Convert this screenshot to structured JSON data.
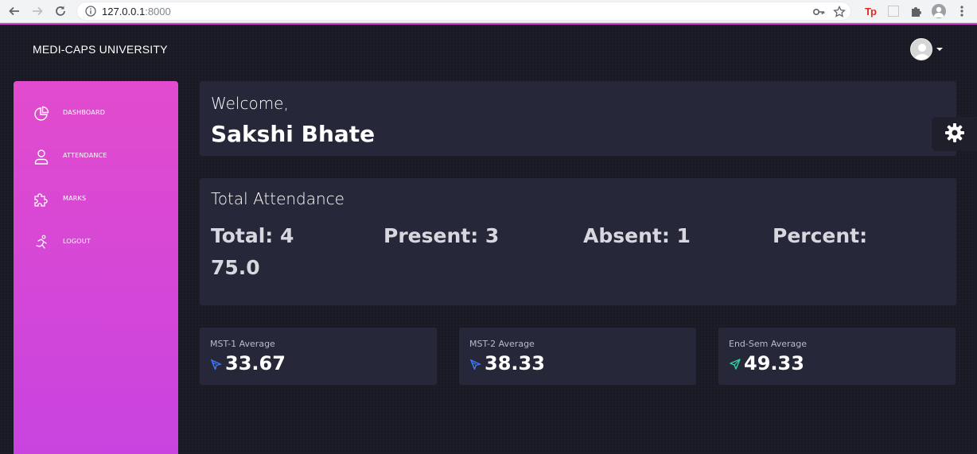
{
  "browser": {
    "url_host": "127.0.0.1",
    "url_port": ":8000",
    "extension_tp": "Tp"
  },
  "app": {
    "brand": "MEDI-CAPS UNIVERSITY",
    "accent_color": "#d63bd0"
  },
  "sidebar": {
    "items": [
      {
        "label": "DASHBOARD",
        "icon": "pie-chart-icon"
      },
      {
        "label": "ATTENDANCE",
        "icon": "user-icon"
      },
      {
        "label": "MARKS",
        "icon": "puzzle-icon"
      },
      {
        "label": "LOGOUT",
        "icon": "running-person-icon"
      }
    ]
  },
  "welcome": {
    "label": "Welcome,",
    "name": "Sakshi Bhate"
  },
  "attendance": {
    "title": "Total Attendance",
    "total": "Total: 4",
    "present": "Present: 3",
    "absent": "Absent: 1",
    "percent_label": "Percent:",
    "percent_value": "75.0"
  },
  "averages": [
    {
      "label": "MST-1 Average",
      "value": "33.67",
      "icon": "pointer-icon",
      "icon_color": "#3f7bff"
    },
    {
      "label": "MST-2 Average",
      "value": "38.33",
      "icon": "pointer-icon",
      "icon_color": "#3f7bff"
    },
    {
      "label": "End-Sem Average",
      "value": "49.33",
      "icon": "paper-plane-icon",
      "icon_color": "#2ed3a6"
    }
  ]
}
